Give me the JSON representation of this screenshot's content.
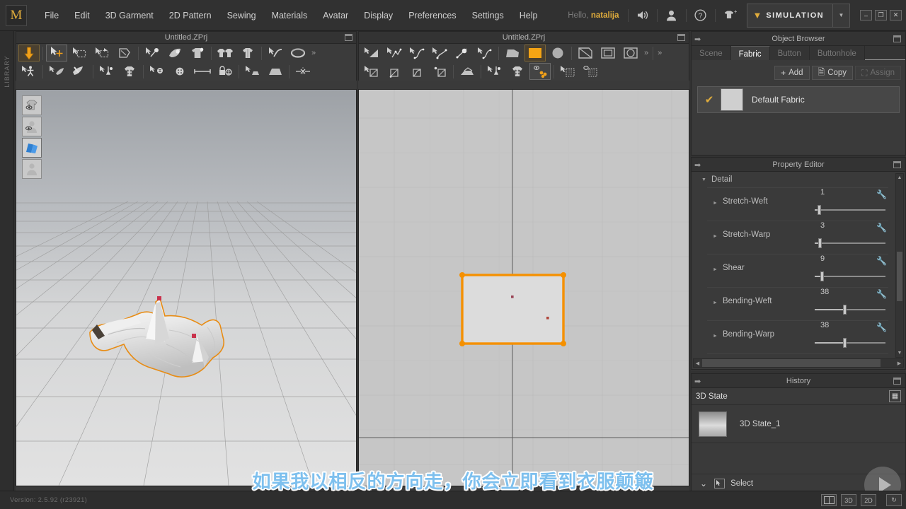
{
  "app": {
    "logo": "M",
    "version_text": "Version: 2.5.92    (r23921)"
  },
  "menubar": {
    "items": [
      "File",
      "Edit",
      "3D Garment",
      "2D Pattern",
      "Sewing",
      "Materials",
      "Avatar",
      "Display",
      "Preferences",
      "Settings",
      "Help"
    ],
    "hello_prefix": "Hello,",
    "user": "natalija",
    "icons": [
      "speaker-icon",
      "user-icon",
      "help-icon",
      "add-garment-icon"
    ],
    "mode": {
      "label": "SIMULATION",
      "chevron": "»"
    },
    "window_controls": [
      "–",
      "❐",
      "✕"
    ]
  },
  "library": {
    "label": "LIBRARY"
  },
  "viewport_3d": {
    "title": "Untitled.ZPrj",
    "toolbar_row1": [
      "gravity-arrow-tool",
      "select-move-tool",
      "box-select-tool",
      "transform-pattern-tool",
      "pin-tool",
      "sew-tool",
      "tack-tool",
      "fold-tool",
      "symmetric-garment-tool",
      "garment-tool",
      "curve-tool",
      "belt-tool"
    ],
    "toolbar_row2": [
      "avatar-pose-tool",
      "gizmo-tool",
      "brush-tool",
      "zipper-tool",
      "button-tool",
      "snap-tool",
      "button-hole-tool",
      "measure-tool",
      "lock-tool",
      "flatten-tool",
      "surface-tool",
      "mirror-tool"
    ],
    "overflow": "»",
    "view_buttons": [
      "show-garment-icon",
      "show-avatar-icon",
      "show-fabric-icon",
      "show-mannequin-icon"
    ],
    "active_view_button_index": 2
  },
  "viewport_2d": {
    "title": "Untitled.ZPrj",
    "toolbar_row1": [
      "polygon-tool",
      "polyline-tool",
      "curve-tool",
      "edit-curve-tool",
      "point-tool",
      "spline-tool",
      "free-shape-tool",
      "rectangle-fill-tool",
      "circle-tool",
      "shape-tool",
      "rectangle-tool",
      "ellipse-tool"
    ],
    "toolbar_row2": [
      "internal-line-tool",
      "internal-polyline-tool",
      "internal-curve-tool",
      "offset-tool",
      "fold-line-tool",
      "zipper-2d-tool",
      "button-2d-tool",
      "pleat-tool",
      "dart-tool",
      "grading-tool"
    ],
    "overflow": "»",
    "active_tool_row1_index": 7,
    "active_tool_row2_index": 7
  },
  "object_browser": {
    "title": "Object Browser",
    "tabs": [
      {
        "label": "Scene",
        "active": false
      },
      {
        "label": "Fabric",
        "active": true
      },
      {
        "label": "Button",
        "active": false
      },
      {
        "label": "Buttonhole",
        "active": false
      }
    ],
    "buttons": [
      {
        "label": "Add",
        "enabled": true,
        "icon": "plus-icon"
      },
      {
        "label": "Copy",
        "enabled": true,
        "icon": "copy-icon"
      },
      {
        "label": "Assign",
        "enabled": false,
        "icon": "assign-icon"
      }
    ],
    "fabrics": [
      {
        "name": "Default Fabric",
        "checked": true,
        "swatch_color": "#cfcfcf"
      }
    ]
  },
  "property_editor": {
    "title": "Property Editor",
    "section": "Detail",
    "properties": [
      {
        "label": "Stretch-Weft",
        "value": "1",
        "pct": 4
      },
      {
        "label": "Stretch-Warp",
        "value": "3",
        "pct": 5
      },
      {
        "label": "Shear",
        "value": "9",
        "pct": 8
      },
      {
        "label": "Bending-Weft",
        "value": "38",
        "pct": 40
      },
      {
        "label": "Bending-Warp",
        "value": "38",
        "pct": 40
      }
    ]
  },
  "history": {
    "title": "History",
    "state_label": "3D State",
    "items": [
      {
        "name": "3D State_1"
      }
    ],
    "select_label": "Select"
  },
  "statusbar": {
    "view_modes": [
      "split-view-icon",
      "3D",
      "2D",
      "reset-icon"
    ]
  },
  "subtitle": {
    "text": "如果我以相反的方向走，你会立即看到衣服颠簸"
  },
  "colors": {
    "accent_orange": "#e8a020",
    "selection_orange": "#f59000",
    "subtitle_blue": "#7ec0ee",
    "panel_bg": "#3a3a3a",
    "chrome_bg": "#313131"
  }
}
